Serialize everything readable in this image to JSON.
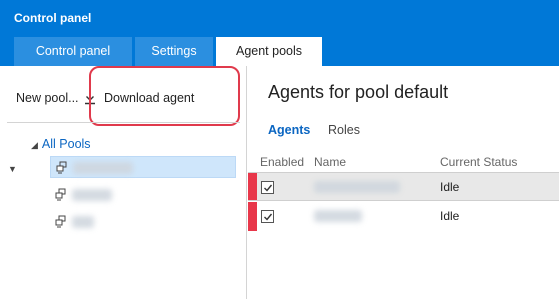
{
  "window": {
    "title": "Control panel"
  },
  "tabs": [
    {
      "label": "Control panel"
    },
    {
      "label": "Settings"
    },
    {
      "label": "Agent pools"
    }
  ],
  "toolbar": {
    "new_pool_label": "New pool...",
    "download_label": "Download agent"
  },
  "tree": {
    "root_label": "All Pools",
    "pool_count": 3
  },
  "main": {
    "title": "Agents for pool default",
    "subtabs": [
      {
        "label": "Agents"
      },
      {
        "label": "Roles"
      }
    ],
    "columns": {
      "enabled": "Enabled",
      "name": "Name",
      "status": "Current Status"
    },
    "rows": [
      {
        "enabled": true,
        "status": "Idle"
      },
      {
        "enabled": true,
        "status": "Idle"
      }
    ]
  },
  "colors": {
    "brand": "#0078d7",
    "accent": "#e8374a",
    "link": "#0b66c2"
  }
}
